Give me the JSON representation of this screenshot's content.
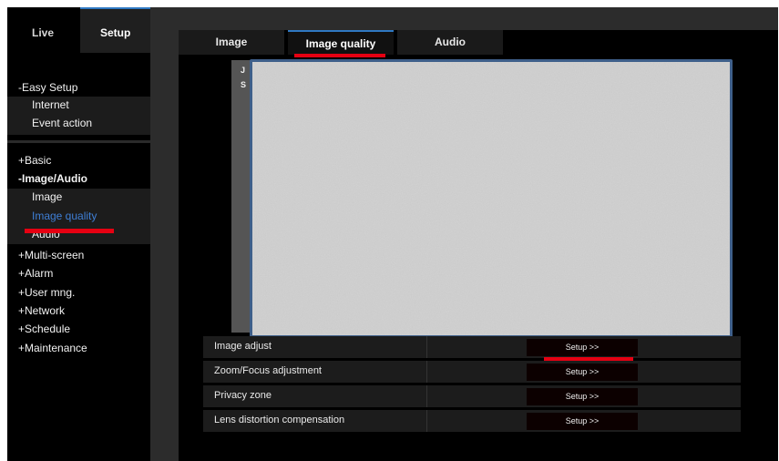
{
  "topnav": {
    "live": "Live",
    "setup": "Setup"
  },
  "sidebar": {
    "easy_setup": "-Easy Setup",
    "easy_setup_items": [
      "Internet",
      "Event action"
    ],
    "basic": "+Basic",
    "image_audio": "-Image/Audio",
    "image_audio_items": [
      "Image",
      "Image quality",
      "Audio"
    ],
    "others": [
      "+Multi-screen",
      "+Alarm",
      "+User mng.",
      "+Network",
      "+Schedule",
      "+Maintenance"
    ]
  },
  "tabs": [
    "Image",
    "Image quality",
    "Audio"
  ],
  "preview": {
    "overlay_line1": "J",
    "overlay_line2": "S"
  },
  "settings": [
    {
      "label": "Image adjust",
      "button": "Setup >>"
    },
    {
      "label": "Zoom/Focus adjustment",
      "button": "Setup >>"
    },
    {
      "label": "Privacy zone",
      "button": "Setup >>"
    },
    {
      "label": "Lens distortion compensation",
      "button": "Setup >>"
    }
  ],
  "colors": {
    "accent": "#2f78c2",
    "active_text": "#3f7fd6",
    "highlight_mark": "#e60012"
  }
}
